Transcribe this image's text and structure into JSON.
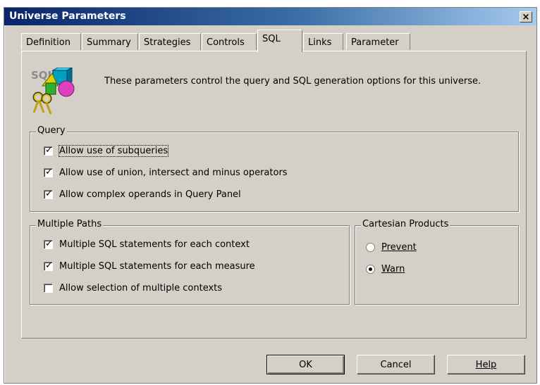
{
  "window": {
    "title": "Universe Parameters",
    "close_glyph": "×"
  },
  "tabs": [
    {
      "label": "Definition"
    },
    {
      "label": "Summary"
    },
    {
      "label": "Strategies"
    },
    {
      "label": "Controls"
    },
    {
      "label": "SQL",
      "active": true
    },
    {
      "label": "Links"
    },
    {
      "label": "Parameter"
    }
  ],
  "header": {
    "icon": "sql-keys-shapes-icon",
    "icon_text": "SQL",
    "description": "These parameters control the query and SQL generation options for this universe."
  },
  "query_group": {
    "title": "Query",
    "options": [
      {
        "label": "Allow use of subqueries",
        "checked": true
      },
      {
        "label": "Allow use of union, intersect and minus operators",
        "checked": true
      },
      {
        "label": "Allow complex operands in Query Panel",
        "checked": true
      }
    ]
  },
  "multiple_paths_group": {
    "title": "Multiple Paths",
    "options": [
      {
        "label": "Multiple SQL statements for each context",
        "checked": true
      },
      {
        "label": "Multiple SQL statements for each measure",
        "checked": true
      },
      {
        "label": "Allow selection of multiple contexts",
        "checked": false
      }
    ]
  },
  "cartesian_group": {
    "title": "Cartesian Products",
    "options": [
      {
        "label": "Prevent",
        "selected": false
      },
      {
        "label": "Warn",
        "selected": true
      }
    ]
  },
  "buttons": {
    "ok": "OK",
    "cancel": "Cancel",
    "help": "Help"
  },
  "colors": {
    "face": "#d4d0c8",
    "titlebar_start": "#0a246a",
    "titlebar_end": "#a6caf0"
  }
}
